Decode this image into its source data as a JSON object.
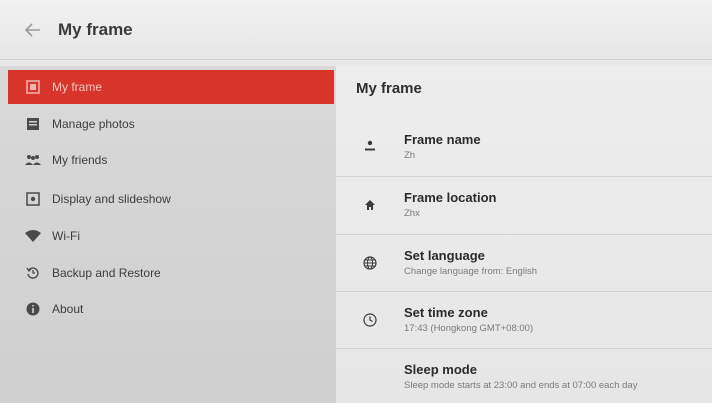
{
  "appbar": {
    "title": "My frame",
    "back_icon": "arrow-left-icon"
  },
  "sidebar": {
    "items": [
      {
        "label": "My frame",
        "icon": "frame-icon",
        "active": true
      },
      {
        "label": "Manage photos",
        "icon": "photos-icon"
      },
      {
        "label": "My friends",
        "icon": "people-icon"
      },
      {
        "label": "Display and slideshow",
        "icon": "display-icon"
      },
      {
        "label": "Wi-Fi",
        "icon": "wifi-icon"
      },
      {
        "label": "Backup and Restore",
        "icon": "restore-icon"
      },
      {
        "label": "About",
        "icon": "info-icon"
      }
    ]
  },
  "content": {
    "header": "My frame",
    "settings": [
      {
        "title": "Frame name",
        "subtitle": "Zh",
        "icon": "person-icon"
      },
      {
        "title": "Frame location",
        "subtitle": "Zhx",
        "icon": "home-icon"
      },
      {
        "title": "Set language",
        "subtitle": "Change language from: English",
        "icon": "globe-icon"
      },
      {
        "title": "Set time zone",
        "subtitle": "17:43 (Hongkong GMT+08:00)",
        "icon": "clock-icon"
      },
      {
        "title": "Sleep mode",
        "subtitle": "Sleep mode starts at 23:00 and ends at 07:00 each day",
        "icon": "moon-icon"
      }
    ]
  },
  "colors": {
    "accent": "#d8342a"
  }
}
